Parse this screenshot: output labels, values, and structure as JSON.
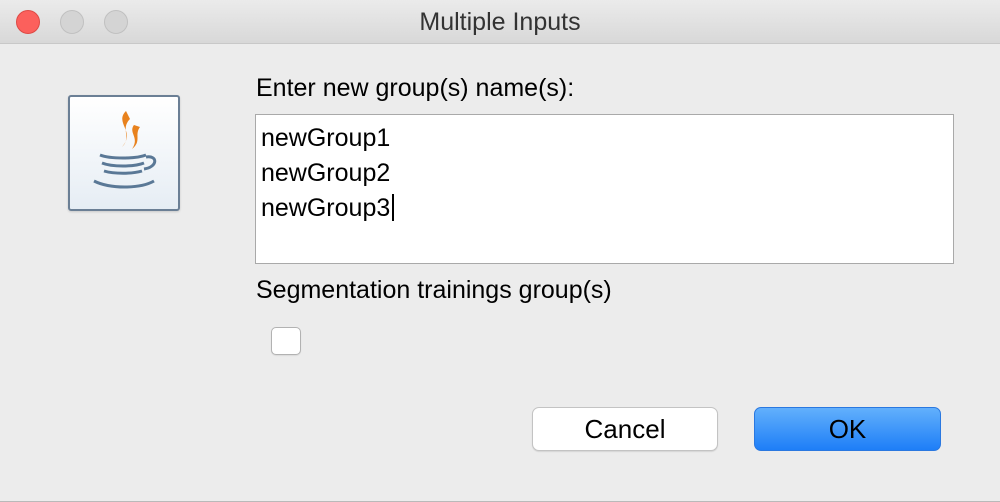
{
  "window": {
    "title": "Multiple Inputs"
  },
  "dialog": {
    "prompt_label": "Enter new group(s) name(s):",
    "group_names": [
      "newGroup1",
      "newGroup2",
      "newGroup3"
    ],
    "checkbox_label": "Segmentation trainings group(s)",
    "checkbox_checked": false
  },
  "buttons": {
    "cancel_label": "Cancel",
    "ok_label": "OK"
  },
  "icons": {
    "app_icon": "java-icon"
  },
  "colors": {
    "ok_button": "#1e7ef7",
    "close_traffic_light": "#fc605c"
  }
}
